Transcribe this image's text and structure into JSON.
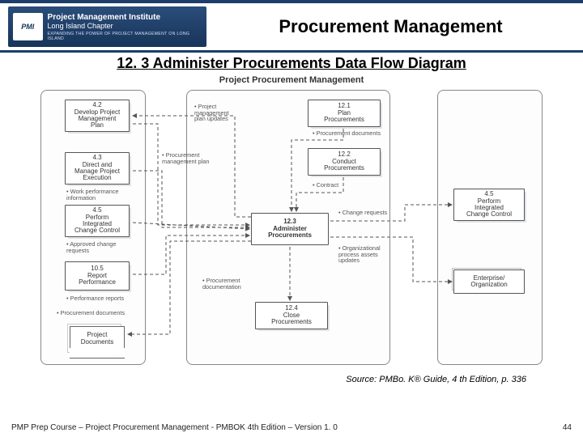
{
  "header": {
    "org_name": "Project Management Institute",
    "chapter": "Long Island Chapter",
    "tagline": "EXPANDING THE POWER OF PROJECT MANAGEMENT ON LONG ISLAND",
    "logo_mark": "PMI",
    "title": "Procurement Management"
  },
  "section_title": "12. 3 Administer Procurements Data Flow Diagram",
  "diagram": {
    "title": "Project Procurement Management",
    "left": {
      "b42": "4.2\nDevelop Project\nManagement\nPlan",
      "b43": "4.3\nDirect and\nManage Project Execution",
      "b45": "4.5\nPerform\nIntegrated\nChange Control",
      "b105": "10.5\nReport\nPerformance",
      "docs": "Project\nDocuments"
    },
    "mid": {
      "b121": "12.1\nPlan\nProcurements",
      "b122": "12.2\nConduct\nProcurements",
      "b123": "12.3\nAdminister\nProcurements",
      "b124": "12.4\nClose\nProcurements"
    },
    "right": {
      "b45r": "4.5\nPerform\nIntegrated\nChange Control",
      "ent": "Enterprise/\nOrganization"
    },
    "labels": {
      "pmp_updates": "Project\nmanagement\nplan updates",
      "pm_plan": "Procurement\nmanagement plan",
      "wpi": "Work performance\ninformation",
      "acr": "Approved change\nrequests",
      "perf": "Performance reports",
      "procdocs_out": "Procurement documents",
      "procdocs_in": "Procurement documents",
      "contract": "Contract",
      "chg_req": "Change requests",
      "opau": "Organizational\nprocess assets\nupdates",
      "procu_docu": "Procurement\ndocumentation"
    }
  },
  "source": "Source: PMBo. K® Guide, 4 th Edition, p. 336",
  "footer": {
    "left": "PMP Prep Course – Project Procurement Management - PMBOK 4th Edition – Version 1. 0",
    "page": "44"
  }
}
